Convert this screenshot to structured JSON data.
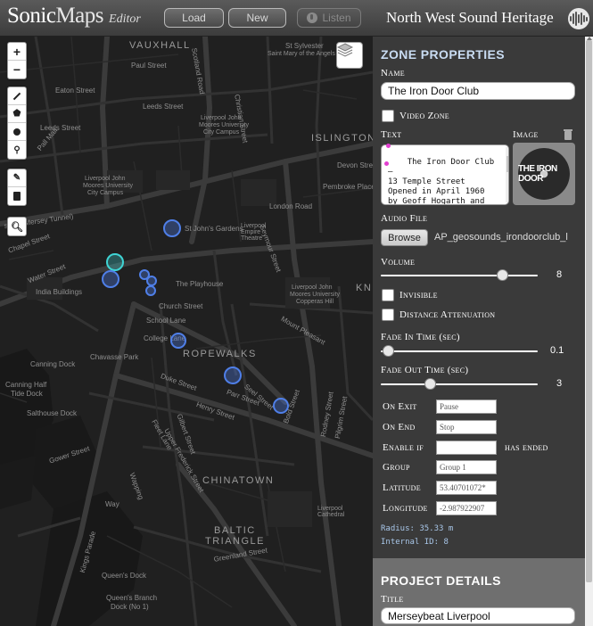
{
  "header": {
    "logo_sonic": "Sonic",
    "logo_maps": "Maps",
    "logo_editor": "Editor",
    "load_label": "Load",
    "new_label": "New",
    "listen_label": "Listen",
    "project_name": "North West Sound Heritage"
  },
  "map": {
    "controls": {
      "zoom_in": "+",
      "zoom_out": "−"
    },
    "labels": {
      "vauxhall": "VAUXHALL",
      "islington": "ISLINGTON",
      "ropewalks": "ROPEWALKS",
      "chinatown": "CHINATOWN",
      "baltic": "BALTIC",
      "triangle": "TRIANGLE",
      "kn": "KN",
      "paul_street": "Paul Street",
      "eaton_street": "Eaton Street",
      "leeds_street": "Leeds Street",
      "leeds_street2": "Leeds Street",
      "pall_mall": "Pall Mall",
      "scotland_road": "Scotland Road",
      "christian_street": "Christian Street",
      "st_sylvester": "St Sylvester",
      "st_mary": "Saint Mary of the Angels",
      "ljmu_city1": "Liverpool John",
      "ljmu_city2": "Moores University",
      "ljmu_city3": "City Campus",
      "ljmu_city4": "Liverpool John",
      "ljmu_city5": "Moores University",
      "ljmu_city6": "City Campus",
      "devon_street": "Devon Street",
      "london_road": "London Road",
      "pembroke_place": "Pembroke Place",
      "seymour_street": "Seymour Street",
      "st_johns": "St John's Gardens",
      "empire": "Liverpool Empire Theatre",
      "mersey_tunnel": "sway (Mersey Tunnel)",
      "chapel_street": "Chapel Street",
      "water_street": "Water Street",
      "india_buildings": "India Buildings",
      "playhouse": "The Playhouse",
      "church_street": "Church Street",
      "ljmu_copperas1": "Liverpool John",
      "ljmu_copperas2": "Moores University",
      "ljmu_copperas3": "Copperas Hill",
      "school_lane": "School Lane",
      "college_lane": "College Lane",
      "mount_pleasant": "Mount Pleasant",
      "chavasse_park": "Chavasse Park",
      "canning_dock": "Canning Dock",
      "canning_half": "Canning Half",
      "tide_dock": "Tide Dock",
      "duke_street": "Duke Street",
      "parr_street": "Parr Street",
      "seel_street": "Seel Street",
      "bold_street": "Bold Street",
      "henry_street": "Henry Street",
      "rodney_street": "Rodney Street",
      "pilgrim_street": "Pilgrim Street",
      "salthouse_dock": "Salthouse Dock",
      "gilbert_street": "Gilbert Street",
      "fleet_lane": "Fleet Lane",
      "upper_frederick": "Upper Frederick Street",
      "gower_street": "Gower Street",
      "wapping": "Wapping",
      "way": "Way",
      "liverpool_cathedral1": "Liverpool",
      "liverpool_cathedral2": "Cathedral",
      "greenland_street": "Greenland Street",
      "kings_parade": "Kings Parade",
      "queens_dock": "Queen's Dock",
      "queens_branch1": "Queen's Branch",
      "queens_branch2": "Dock (No 1)"
    }
  },
  "zone_properties": {
    "section_title": "ZONE PROPERTIES",
    "name_label": "Name",
    "name_value": "The Iron Door Club",
    "video_zone_label": "Video Zone",
    "text_label": "Text",
    "image_label": "Image",
    "text_value": "The Iron Door Club –\n13 Temple Street\nOpened in April 1960\nby Geoff Hogarth and\nHarry Ormesher, the\nIron Door was one of",
    "image_caption": "THE IRON DOOR",
    "audio_file_label": "Audio File",
    "browse_label": "Browse",
    "audio_file_name": "AP_geosounds_irondoorclub_l",
    "volume_label": "Volume",
    "volume_value": "8",
    "volume_fraction": 0.8,
    "invisible_label": "Invisible",
    "distance_attenuation_label": "Distance Attenuation",
    "fade_in_label": "Fade In Time (sec)",
    "fade_in_value": "0.1",
    "fade_in_fraction": 0.01,
    "fade_out_label": "Fade Out Time (sec)",
    "fade_out_value": "3",
    "fade_out_fraction": 0.3,
    "on_exit_label": "On Exit",
    "on_exit_value": "Pause",
    "on_end_label": "On End",
    "on_end_value": "Stop",
    "enable_if_label": "Enable if",
    "enable_if_value": "",
    "has_ended_label": "has ended",
    "group_label": "Group",
    "group_value": "Group 1",
    "latitude_label": "Latitude",
    "latitude_value": "53.40701072*",
    "longitude_label": "Longitude",
    "longitude_value": "-2.987922907",
    "radius_text": "Radius: 35.33 m",
    "internal_id_text": "Internal ID: 8"
  },
  "project_details": {
    "section_title": "PROJECT DETAILS",
    "title_label": "Title",
    "title_value": "Merseybeat Liverpool"
  }
}
